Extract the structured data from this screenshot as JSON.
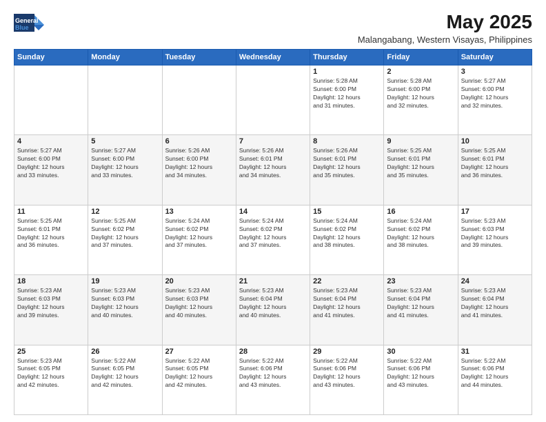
{
  "header": {
    "logo_line1": "General",
    "logo_line2": "Blue",
    "title": "May 2025",
    "subtitle": "Malangabang, Western Visayas, Philippines"
  },
  "days_of_week": [
    "Sunday",
    "Monday",
    "Tuesday",
    "Wednesday",
    "Thursday",
    "Friday",
    "Saturday"
  ],
  "weeks": [
    [
      {
        "day": "",
        "info": ""
      },
      {
        "day": "",
        "info": ""
      },
      {
        "day": "",
        "info": ""
      },
      {
        "day": "",
        "info": ""
      },
      {
        "day": "1",
        "info": "Sunrise: 5:28 AM\nSunset: 6:00 PM\nDaylight: 12 hours\nand 31 minutes."
      },
      {
        "day": "2",
        "info": "Sunrise: 5:28 AM\nSunset: 6:00 PM\nDaylight: 12 hours\nand 32 minutes."
      },
      {
        "day": "3",
        "info": "Sunrise: 5:27 AM\nSunset: 6:00 PM\nDaylight: 12 hours\nand 32 minutes."
      }
    ],
    [
      {
        "day": "4",
        "info": "Sunrise: 5:27 AM\nSunset: 6:00 PM\nDaylight: 12 hours\nand 33 minutes."
      },
      {
        "day": "5",
        "info": "Sunrise: 5:27 AM\nSunset: 6:00 PM\nDaylight: 12 hours\nand 33 minutes."
      },
      {
        "day": "6",
        "info": "Sunrise: 5:26 AM\nSunset: 6:00 PM\nDaylight: 12 hours\nand 34 minutes."
      },
      {
        "day": "7",
        "info": "Sunrise: 5:26 AM\nSunset: 6:01 PM\nDaylight: 12 hours\nand 34 minutes."
      },
      {
        "day": "8",
        "info": "Sunrise: 5:26 AM\nSunset: 6:01 PM\nDaylight: 12 hours\nand 35 minutes."
      },
      {
        "day": "9",
        "info": "Sunrise: 5:25 AM\nSunset: 6:01 PM\nDaylight: 12 hours\nand 35 minutes."
      },
      {
        "day": "10",
        "info": "Sunrise: 5:25 AM\nSunset: 6:01 PM\nDaylight: 12 hours\nand 36 minutes."
      }
    ],
    [
      {
        "day": "11",
        "info": "Sunrise: 5:25 AM\nSunset: 6:01 PM\nDaylight: 12 hours\nand 36 minutes."
      },
      {
        "day": "12",
        "info": "Sunrise: 5:25 AM\nSunset: 6:02 PM\nDaylight: 12 hours\nand 37 minutes."
      },
      {
        "day": "13",
        "info": "Sunrise: 5:24 AM\nSunset: 6:02 PM\nDaylight: 12 hours\nand 37 minutes."
      },
      {
        "day": "14",
        "info": "Sunrise: 5:24 AM\nSunset: 6:02 PM\nDaylight: 12 hours\nand 37 minutes."
      },
      {
        "day": "15",
        "info": "Sunrise: 5:24 AM\nSunset: 6:02 PM\nDaylight: 12 hours\nand 38 minutes."
      },
      {
        "day": "16",
        "info": "Sunrise: 5:24 AM\nSunset: 6:02 PM\nDaylight: 12 hours\nand 38 minutes."
      },
      {
        "day": "17",
        "info": "Sunrise: 5:23 AM\nSunset: 6:03 PM\nDaylight: 12 hours\nand 39 minutes."
      }
    ],
    [
      {
        "day": "18",
        "info": "Sunrise: 5:23 AM\nSunset: 6:03 PM\nDaylight: 12 hours\nand 39 minutes."
      },
      {
        "day": "19",
        "info": "Sunrise: 5:23 AM\nSunset: 6:03 PM\nDaylight: 12 hours\nand 40 minutes."
      },
      {
        "day": "20",
        "info": "Sunrise: 5:23 AM\nSunset: 6:03 PM\nDaylight: 12 hours\nand 40 minutes."
      },
      {
        "day": "21",
        "info": "Sunrise: 5:23 AM\nSunset: 6:04 PM\nDaylight: 12 hours\nand 40 minutes."
      },
      {
        "day": "22",
        "info": "Sunrise: 5:23 AM\nSunset: 6:04 PM\nDaylight: 12 hours\nand 41 minutes."
      },
      {
        "day": "23",
        "info": "Sunrise: 5:23 AM\nSunset: 6:04 PM\nDaylight: 12 hours\nand 41 minutes."
      },
      {
        "day": "24",
        "info": "Sunrise: 5:23 AM\nSunset: 6:04 PM\nDaylight: 12 hours\nand 41 minutes."
      }
    ],
    [
      {
        "day": "25",
        "info": "Sunrise: 5:23 AM\nSunset: 6:05 PM\nDaylight: 12 hours\nand 42 minutes."
      },
      {
        "day": "26",
        "info": "Sunrise: 5:22 AM\nSunset: 6:05 PM\nDaylight: 12 hours\nand 42 minutes."
      },
      {
        "day": "27",
        "info": "Sunrise: 5:22 AM\nSunset: 6:05 PM\nDaylight: 12 hours\nand 42 minutes."
      },
      {
        "day": "28",
        "info": "Sunrise: 5:22 AM\nSunset: 6:06 PM\nDaylight: 12 hours\nand 43 minutes."
      },
      {
        "day": "29",
        "info": "Sunrise: 5:22 AM\nSunset: 6:06 PM\nDaylight: 12 hours\nand 43 minutes."
      },
      {
        "day": "30",
        "info": "Sunrise: 5:22 AM\nSunset: 6:06 PM\nDaylight: 12 hours\nand 43 minutes."
      },
      {
        "day": "31",
        "info": "Sunrise: 5:22 AM\nSunset: 6:06 PM\nDaylight: 12 hours\nand 44 minutes."
      }
    ]
  ]
}
